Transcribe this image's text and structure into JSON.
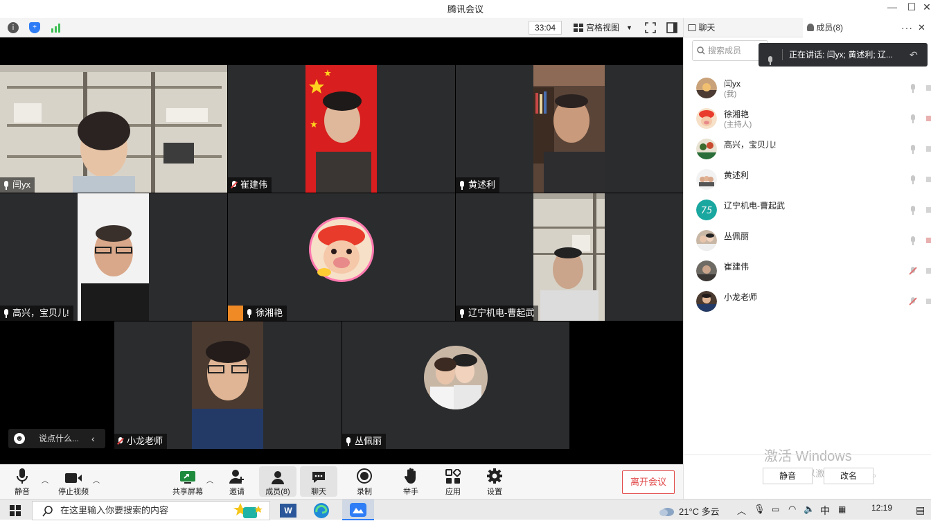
{
  "window": {
    "title": "腾讯会议"
  },
  "toolbar": {
    "timer": "33:04",
    "view_label": "宫格视图"
  },
  "participants_tiles": [
    {
      "name": "闫yx",
      "muted": false,
      "active": true
    },
    {
      "name": "崔建伟",
      "muted": true,
      "active": false
    },
    {
      "name": "黄述利",
      "muted": false,
      "active": false
    },
    {
      "name": "高兴，宝贝儿!",
      "muted": false,
      "active": false
    },
    {
      "name": "徐湘艳",
      "muted": false,
      "active": false
    },
    {
      "name": "辽宁机电-曹起武",
      "muted": false,
      "active": false
    },
    {
      "name": "小龙老师",
      "muted": true,
      "active": false
    },
    {
      "name": "丛佩丽",
      "muted": false,
      "active": false
    }
  ],
  "chat_quick": {
    "placeholder": "说点什么..."
  },
  "bottombar": {
    "mute": "静音",
    "stop_video": "停止视频",
    "share": "共享屏幕",
    "invite": "邀请",
    "members": "成员(8)",
    "chat": "聊天",
    "record": "录制",
    "raise_hand": "举手",
    "apps": "应用",
    "settings": "设置",
    "leave": "离开会议"
  },
  "panel": {
    "tab_chat": "聊天",
    "tab_members": "成员(8)",
    "search_placeholder": "搜索成员",
    "speaking": "正在讲话: 闫yx; 黄述利; 辽...",
    "members": [
      {
        "name": "闫yx",
        "role": "(我)",
        "muted": false,
        "cam_off": false
      },
      {
        "name": "徐湘艳",
        "role": "(主持人)",
        "muted": false,
        "cam_off": true
      },
      {
        "name": "高兴，宝贝儿!",
        "role": "",
        "muted": false,
        "cam_off": false
      },
      {
        "name": "黄述利",
        "role": "",
        "muted": false,
        "cam_off": false
      },
      {
        "name": "辽宁机电-曹起武",
        "role": "",
        "muted": false,
        "cam_off": false
      },
      {
        "name": "丛佩丽",
        "role": "",
        "muted": false,
        "cam_off": true
      },
      {
        "name": "崔建伟",
        "role": "",
        "muted": true,
        "cam_off": false
      },
      {
        "name": "小龙老师",
        "role": "",
        "muted": true,
        "cam_off": false
      }
    ],
    "mute_all": "静音",
    "rename": "改名",
    "watermark_line1": "激活 Windows",
    "watermark_line2": "转到\"设置\"以激活 Windows。"
  },
  "taskbar": {
    "search_placeholder": "在这里输入你要搜索的内容",
    "weather": "21°C  多云",
    "ime": "中",
    "time": "12:19"
  },
  "colors": {
    "accent": "#2f7df6",
    "active_speaker": "#3fbf55",
    "leave": "#e24a4a",
    "tile_bg": "#2b2c2e"
  }
}
